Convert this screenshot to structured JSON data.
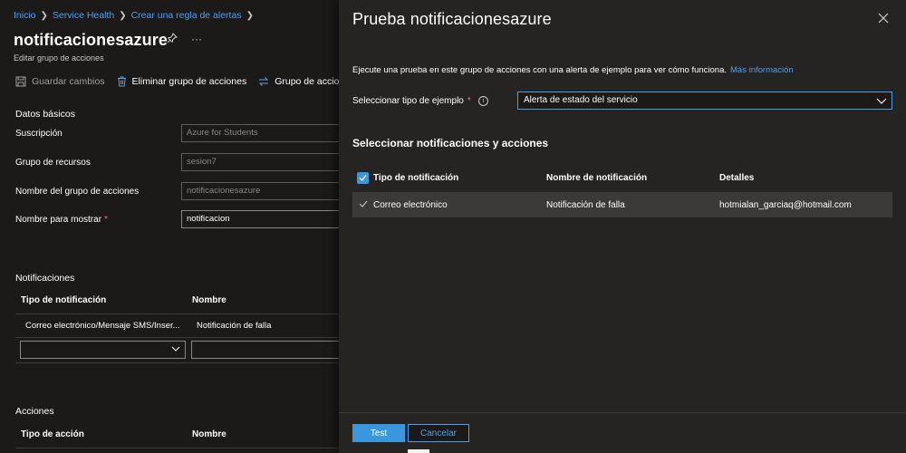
{
  "breadcrumb": {
    "items": [
      "Inicio",
      "Service Health",
      "Crear una regla de alertas"
    ]
  },
  "blade": {
    "title": "notificacionesazure",
    "subtitle": "Editar grupo de acciones",
    "icons": [
      "pin-icon",
      "more-icon"
    ]
  },
  "toolbar": {
    "save_label": "Guardar cambios",
    "delete_label": "Eliminar grupo de acciones",
    "group_label": "Grupo de acciones de"
  },
  "basics": {
    "heading": "Datos básicos",
    "subscription_label": "Suscripción",
    "subscription_value": "Azure for Students",
    "resource_group_label": "Grupo de recursos",
    "resource_group_value": "sesion7",
    "group_name_label": "Nombre del grupo de acciones",
    "group_name_value": "notificacionesazure",
    "display_name_label": "Nombre para mostrar",
    "display_name_required": "*",
    "display_name_value": "notificacion"
  },
  "notifications": {
    "heading": "Notificaciones",
    "columns": [
      "Tipo de notificación",
      "Nombre"
    ],
    "rows": [
      {
        "type": "Correo electrónico/Mensaje SMS/Inser...",
        "name": "Notificación de falla"
      }
    ]
  },
  "actions": {
    "heading": "Acciones",
    "columns": [
      "Tipo de acción",
      "Nombre"
    ]
  },
  "panel": {
    "title": "Prueba notificacionesazure",
    "description": "Ejecute una prueba en este grupo de acciones con una alerta de ejemplo para ver cómo funciona.",
    "more_info_link": "Más información",
    "select_label": "Seleccionar tipo de ejemplo",
    "select_required": "*",
    "select_value": "Alerta de estado del servicio",
    "section_heading": "Seleccionar notificaciones y acciones",
    "grid_columns": [
      "Tipo de notificación",
      "Nombre de notificación",
      "Detalles"
    ],
    "grid_rows": [
      {
        "type": "Correo electrónico",
        "name": "Notificación de falla",
        "details": "hotmialan_garciaq@hotmail.com"
      }
    ],
    "test_button": "Test",
    "cancel_button": "Cancelar"
  },
  "colors": {
    "accent": "#3a96dd",
    "link": "#4ba0ee",
    "background": "#1b1a19",
    "panel": "#252423",
    "required": "#f1707b"
  }
}
